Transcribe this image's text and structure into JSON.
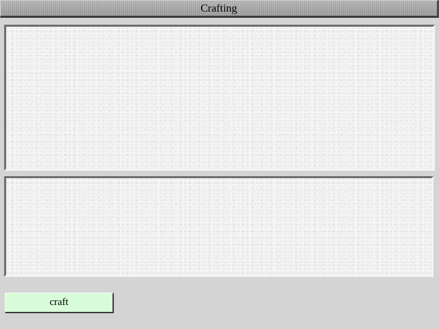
{
  "window": {
    "title": "Crafting"
  },
  "actions": {
    "craft_label": "craft"
  },
  "colors": {
    "background": "#d4d4d4",
    "title_bar": "#b0b0b0",
    "panel": "#f3f3f3",
    "craft_button": "#d8fcd8"
  }
}
